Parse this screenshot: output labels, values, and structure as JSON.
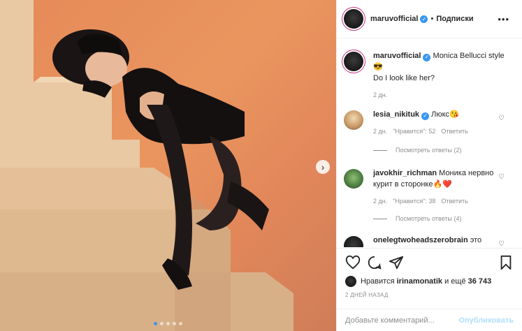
{
  "post": {
    "carousel": {
      "slide_count": 5,
      "active_slide": 1,
      "next_icon": "chevron-right-icon"
    }
  },
  "header": {
    "username": "maruvofficial",
    "separator": "•",
    "follow_label": "Подписки",
    "more_icon": "•••"
  },
  "caption": {
    "username": "maruvofficial",
    "text_line1": "Monica Bellucci style",
    "emoji": "😎",
    "text_line2": "Do I look like her?",
    "time": "2 дн."
  },
  "comments": [
    {
      "username": "lesia_nikituk",
      "verified": true,
      "text": "Люкс😘",
      "time": "2 дн.",
      "likes": "\"Нравится\": 52",
      "reply_label": "Ответить",
      "view_replies": "Посмотреть ответы (2)"
    },
    {
      "username": "javokhir_richman",
      "verified": false,
      "text": "Моника нервно курит в сторонке🔥❤️",
      "time": "2 дн.",
      "likes": "\"Нравится\": 38",
      "reply_label": "Ответить",
      "view_replies": "Посмотреть ответы (4)"
    },
    {
      "username": "onelegtwoheadszerobrain",
      "verified": false,
      "text": "это"
    }
  ],
  "actions": {
    "likes_prefix": "Нравится",
    "likes_user": "irinamonatik",
    "likes_middle": "и ещё",
    "likes_count": "36 743",
    "date": "2 ДНЕЙ НАЗАД"
  },
  "add_comment": {
    "placeholder": "Добавьте комментарий...",
    "publish_label": "Опубликовать"
  },
  "colors": {
    "accent": "#3897f0",
    "publish_disabled": "#b2dffc",
    "photo_bg": "#e58a58"
  }
}
